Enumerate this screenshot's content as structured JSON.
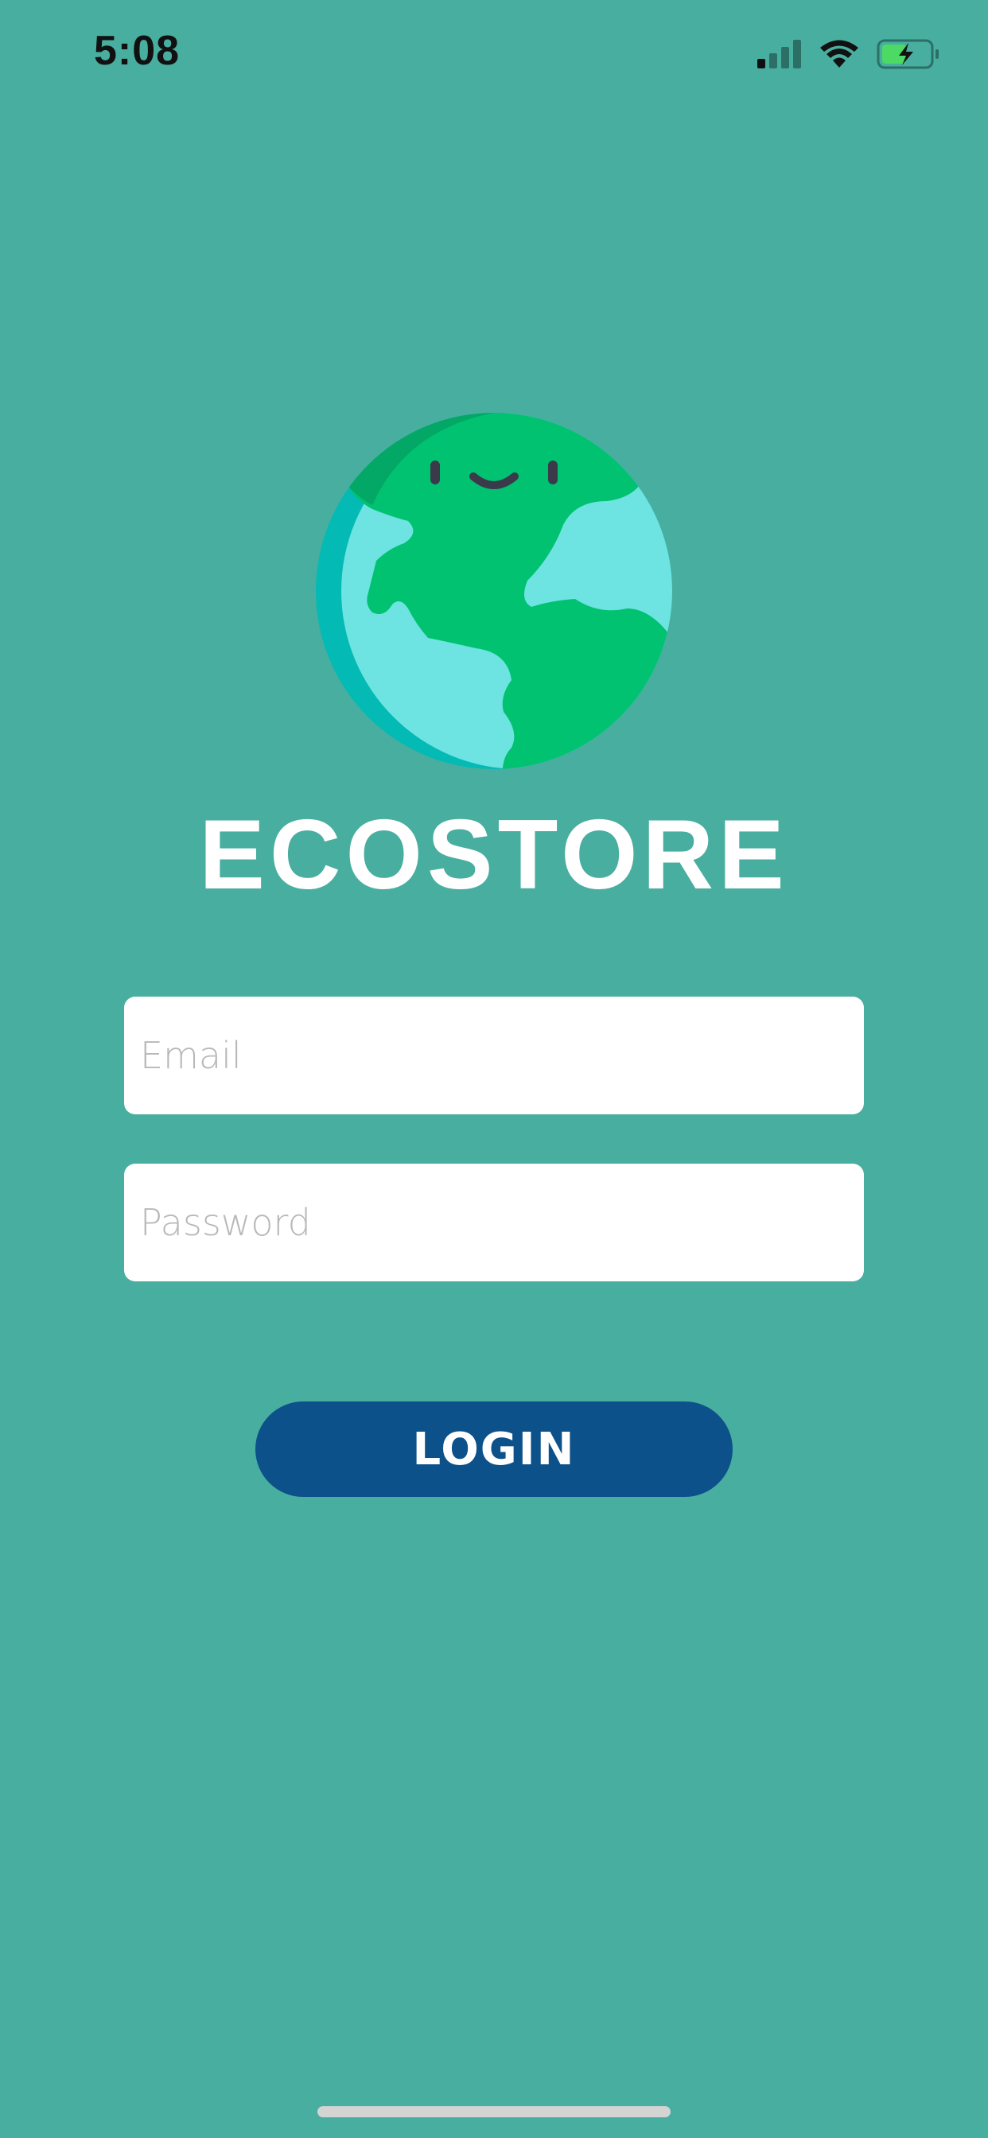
{
  "status_bar": {
    "time": "5:08",
    "icons": [
      "cellular-signal-icon",
      "wifi-icon",
      "battery-charging-icon"
    ]
  },
  "branding": {
    "logo_icon": "smiling-earth-globe-icon",
    "app_name": "ECOSTORE"
  },
  "form": {
    "email_placeholder": "Email",
    "email_value": "",
    "password_placeholder": "Password",
    "password_value": "",
    "login_label": "LOGIN"
  },
  "colors": {
    "background": "#48ae9f",
    "button": "#0d518a",
    "globe_land": "#00c271",
    "globe_water": "#6de4e1",
    "globe_shadow": "#04bab5"
  }
}
